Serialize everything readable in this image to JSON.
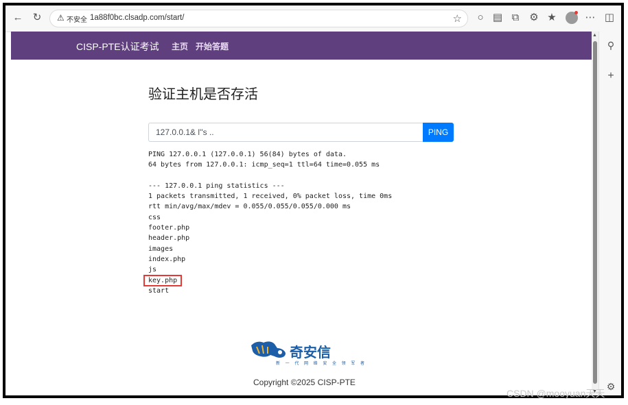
{
  "browser": {
    "security_label": "不安全",
    "url": "1a88f0bc.clsadp.com/start/"
  },
  "navbar": {
    "brand": "CISP-PTE认证考试",
    "links": [
      "主页",
      "开始答题"
    ]
  },
  "main": {
    "title": "验证主机是否存活",
    "input_value": "127.0.0.1& l''s ..",
    "button_label": "PING",
    "output_lines": [
      "PING 127.0.0.1 (127.0.0.1) 56(84) bytes of data.",
      "64 bytes from 127.0.0.1: icmp_seq=1 ttl=64 time=0.055 ms",
      "",
      "--- 127.0.0.1 ping statistics ---",
      "1 packets transmitted, 1 received, 0% packet loss, time 0ms",
      "rtt min/avg/max/mdev = 0.055/0.055/0.055/0.000 ms",
      "css",
      "footer.php",
      "header.php",
      "images",
      "index.php",
      "js",
      "key.php",
      "start"
    ]
  },
  "footer": {
    "logo_text": "奇安信",
    "logo_subtitle": "新 一 代 网 络 安 全 领 军 者",
    "copyright": "Copyright ©2025 CISP-PTE"
  },
  "watermark": "CSDN @mooyuan天天",
  "colors": {
    "navbar": "#5f3f7e",
    "button": "#007bff",
    "highlight": "#e53935",
    "logo": "#1c5fa8"
  }
}
